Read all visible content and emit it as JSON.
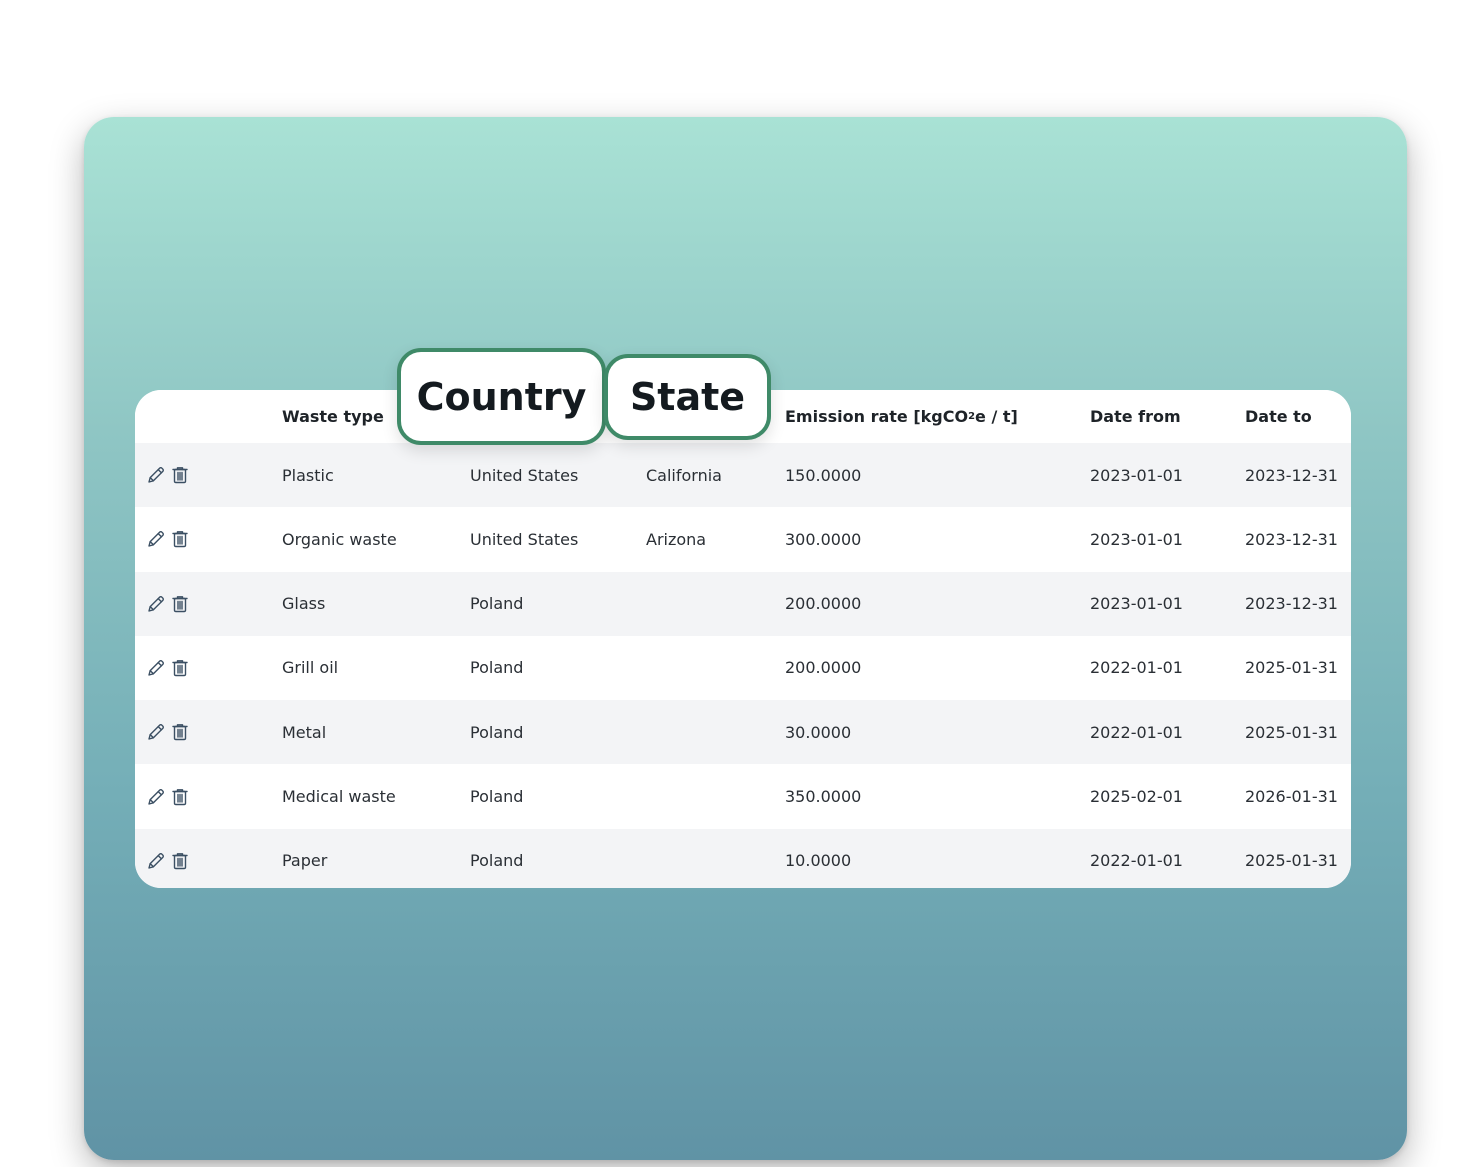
{
  "table": {
    "headers": {
      "waste_type": "Waste type",
      "emission_rate_prefix": "Emission rate [kgCO",
      "emission_rate_sub": "2",
      "emission_rate_suffix": "e / t]",
      "date_from": "Date from",
      "date_to": "Date to"
    },
    "rows": [
      {
        "waste_type": "Plastic",
        "country": "United States",
        "state": "California",
        "rate": "150.0000",
        "date_from": "2023-01-01",
        "date_to": "2023-12-31"
      },
      {
        "waste_type": "Organic waste",
        "country": "United States",
        "state": "Arizona",
        "rate": "300.0000",
        "date_from": "2023-01-01",
        "date_to": "2023-12-31"
      },
      {
        "waste_type": "Glass",
        "country": "Poland",
        "state": "",
        "rate": "200.0000",
        "date_from": "2023-01-01",
        "date_to": "2023-12-31"
      },
      {
        "waste_type": "Grill oil",
        "country": "Poland",
        "state": "",
        "rate": "200.0000",
        "date_from": "2022-01-01",
        "date_to": "2025-01-31"
      },
      {
        "waste_type": "Metal",
        "country": "Poland",
        "state": "",
        "rate": "30.0000",
        "date_from": "2022-01-01",
        "date_to": "2025-01-31"
      },
      {
        "waste_type": "Medical waste",
        "country": "Poland",
        "state": "",
        "rate": "350.0000",
        "date_from": "2025-02-01",
        "date_to": "2026-01-31"
      },
      {
        "waste_type": "Paper",
        "country": "Poland",
        "state": "",
        "rate": "10.0000",
        "date_from": "2022-01-01",
        "date_to": "2025-01-31"
      }
    ],
    "row_icons": [
      "pencil-icon",
      "trash-icon"
    ]
  },
  "callouts": {
    "country": "Country",
    "state": "State"
  },
  "colors": {
    "callout_border": "#3f8a68",
    "gradient_top": "#a9e2d5",
    "gradient_bottom": "#6093a5",
    "row_stripe": "#f3f4f6",
    "icon_stroke": "#3b4f63"
  }
}
